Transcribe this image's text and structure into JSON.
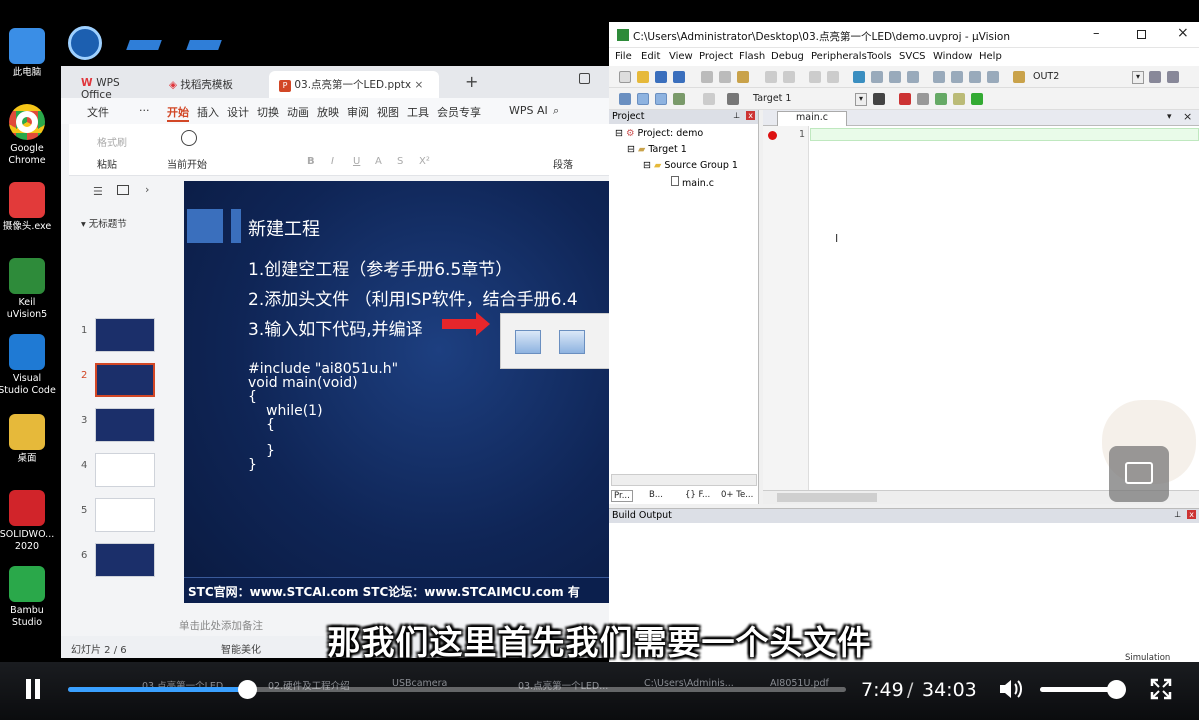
{
  "desktop": {
    "icons": [
      {
        "label": "此电脑",
        "icon": "computer-icon",
        "color": "#3a8ee6"
      },
      {
        "label": "Google Chrome",
        "icon": "chrome-icon",
        "color": "#e04a3a"
      },
      {
        "label": "摄像头.exe",
        "icon": "camera-icon",
        "color": "#e23a3a"
      },
      {
        "label": "Keil uVision5",
        "icon": "keil-icon",
        "color": "#2e8b3a"
      },
      {
        "label": "Visual Studio Code",
        "icon": "vscode-icon",
        "color": "#1f7ad4"
      },
      {
        "label": "桌面",
        "icon": "folder-icon",
        "color": "#e6b93a"
      },
      {
        "label": "SOLIDWO... 2020",
        "icon": "solidworks-icon",
        "color": "#d1242a"
      },
      {
        "label": "Bambu Studio",
        "icon": "bambu-icon",
        "color": "#2aa84a"
      }
    ]
  },
  "wps": {
    "tabs": [
      "WPS Office",
      "找稻壳模板",
      "03.点亮第一个LED.pptx"
    ],
    "menu": [
      "文件",
      "···",
      "开始",
      "插入",
      "设计",
      "切换",
      "动画",
      "放映",
      "审阅",
      "视图",
      "工具",
      "会员专享",
      "WPS AI"
    ],
    "ribbon": {
      "format_painter": "格式刷",
      "paste": "粘贴",
      "start_from_current": "当前开始",
      "paragraph": "段落",
      "font_b": "B",
      "font_i": "I",
      "font_u": "U",
      "font_a": "A",
      "font_s": "S",
      "sup": "X²"
    },
    "sidebar": {
      "section": "无标题节",
      "slides": [
        "1",
        "2",
        "3",
        "4",
        "5",
        "6"
      ],
      "add": "+"
    },
    "slide": {
      "title": "新建工程",
      "steps": [
        "1.创建空工程（参考手册6.5章节）",
        "2.添加头文件 （利用ISP软件，结合手册6.4",
        "3.输入如下代码,并编译"
      ],
      "code": [
        "#include \"ai8051u.h\"",
        "void main(void)",
        "{",
        "while(1)",
        "{",
        "}",
        "}"
      ],
      "footer": "STC官网：www.STCAI.com      STC论坛：www.STCAIMCU.com      有"
    },
    "notes_placeholder": "单击此处添加备注",
    "status": {
      "slide_count": "幻灯片 2 / 6",
      "beautify": "智能美化"
    }
  },
  "uvision": {
    "title": "C:\\Users\\Administrator\\Desktop\\03.点亮第一个LED\\demo.uvproj - µVision",
    "menu": [
      "File",
      "Edit",
      "View",
      "Project",
      "Flash",
      "Debug",
      "Peripherals",
      "Tools",
      "SVCS",
      "Window",
      "Help"
    ],
    "toolbar_combo": "OUT2",
    "target_combo": "Target 1",
    "project_pane": {
      "header": "Project",
      "tree": [
        "Project: demo",
        "Target 1",
        "Source Group 1",
        "main.c"
      ],
      "tabs": [
        "Pr...",
        "B...",
        "{} F...",
        "0+ Te..."
      ]
    },
    "editor": {
      "tab": "main.c",
      "line_number": "1"
    },
    "build_output": {
      "header": "Build Output",
      "status": "Simulation"
    }
  },
  "video": {
    "subtitle": "那我们这里首先我们需要一个头文件",
    "current_time": "7:49",
    "separator": "/",
    "total_time": "34:03",
    "progress": 0.2295,
    "volume": 0.88,
    "taskbar": [
      "03.点亮第一个LED",
      "02.硬件及工程介绍",
      "USBcamera",
      "03.点亮第一个LED...",
      "C:\\Users\\Adminis...",
      "AI8051U.pdf"
    ]
  }
}
